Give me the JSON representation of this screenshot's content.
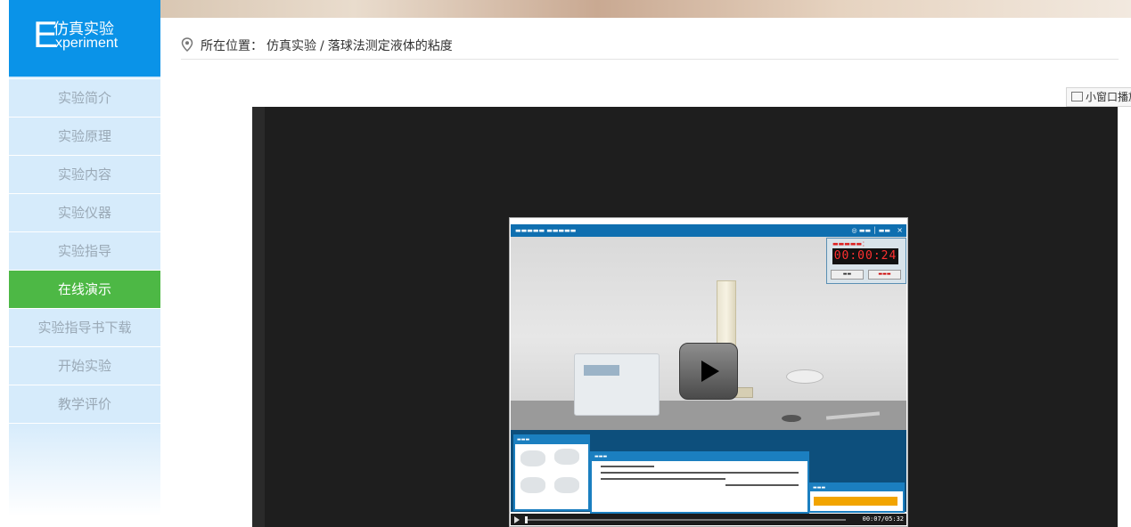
{
  "logo": {
    "letter": "E",
    "title_cn": "仿真实验",
    "title_en": "xperiment"
  },
  "sidebar": {
    "items": [
      {
        "label": "实验简介",
        "active": false
      },
      {
        "label": "实验原理",
        "active": false
      },
      {
        "label": "实验内容",
        "active": false
      },
      {
        "label": "实验仪器",
        "active": false
      },
      {
        "label": "实验指导",
        "active": false
      },
      {
        "label": "在线演示",
        "active": true
      },
      {
        "label": "实验指导书下载",
        "active": false
      },
      {
        "label": "开始实验",
        "active": false
      },
      {
        "label": "教学评价",
        "active": false
      }
    ]
  },
  "breadcrumb": {
    "prefix": "所在位置：",
    "section": "仿真实验",
    "separator": "/",
    "page": "落球法测定液体的粘度"
  },
  "mini_window_button": "小窗口播放",
  "video": {
    "timer": "00:00:24",
    "elapsed": "00:07",
    "total": "05:32"
  },
  "colors": {
    "accent": "#0a93e8",
    "active_nav": "#4db845",
    "sidebar_bg": "#d6ebfb"
  }
}
